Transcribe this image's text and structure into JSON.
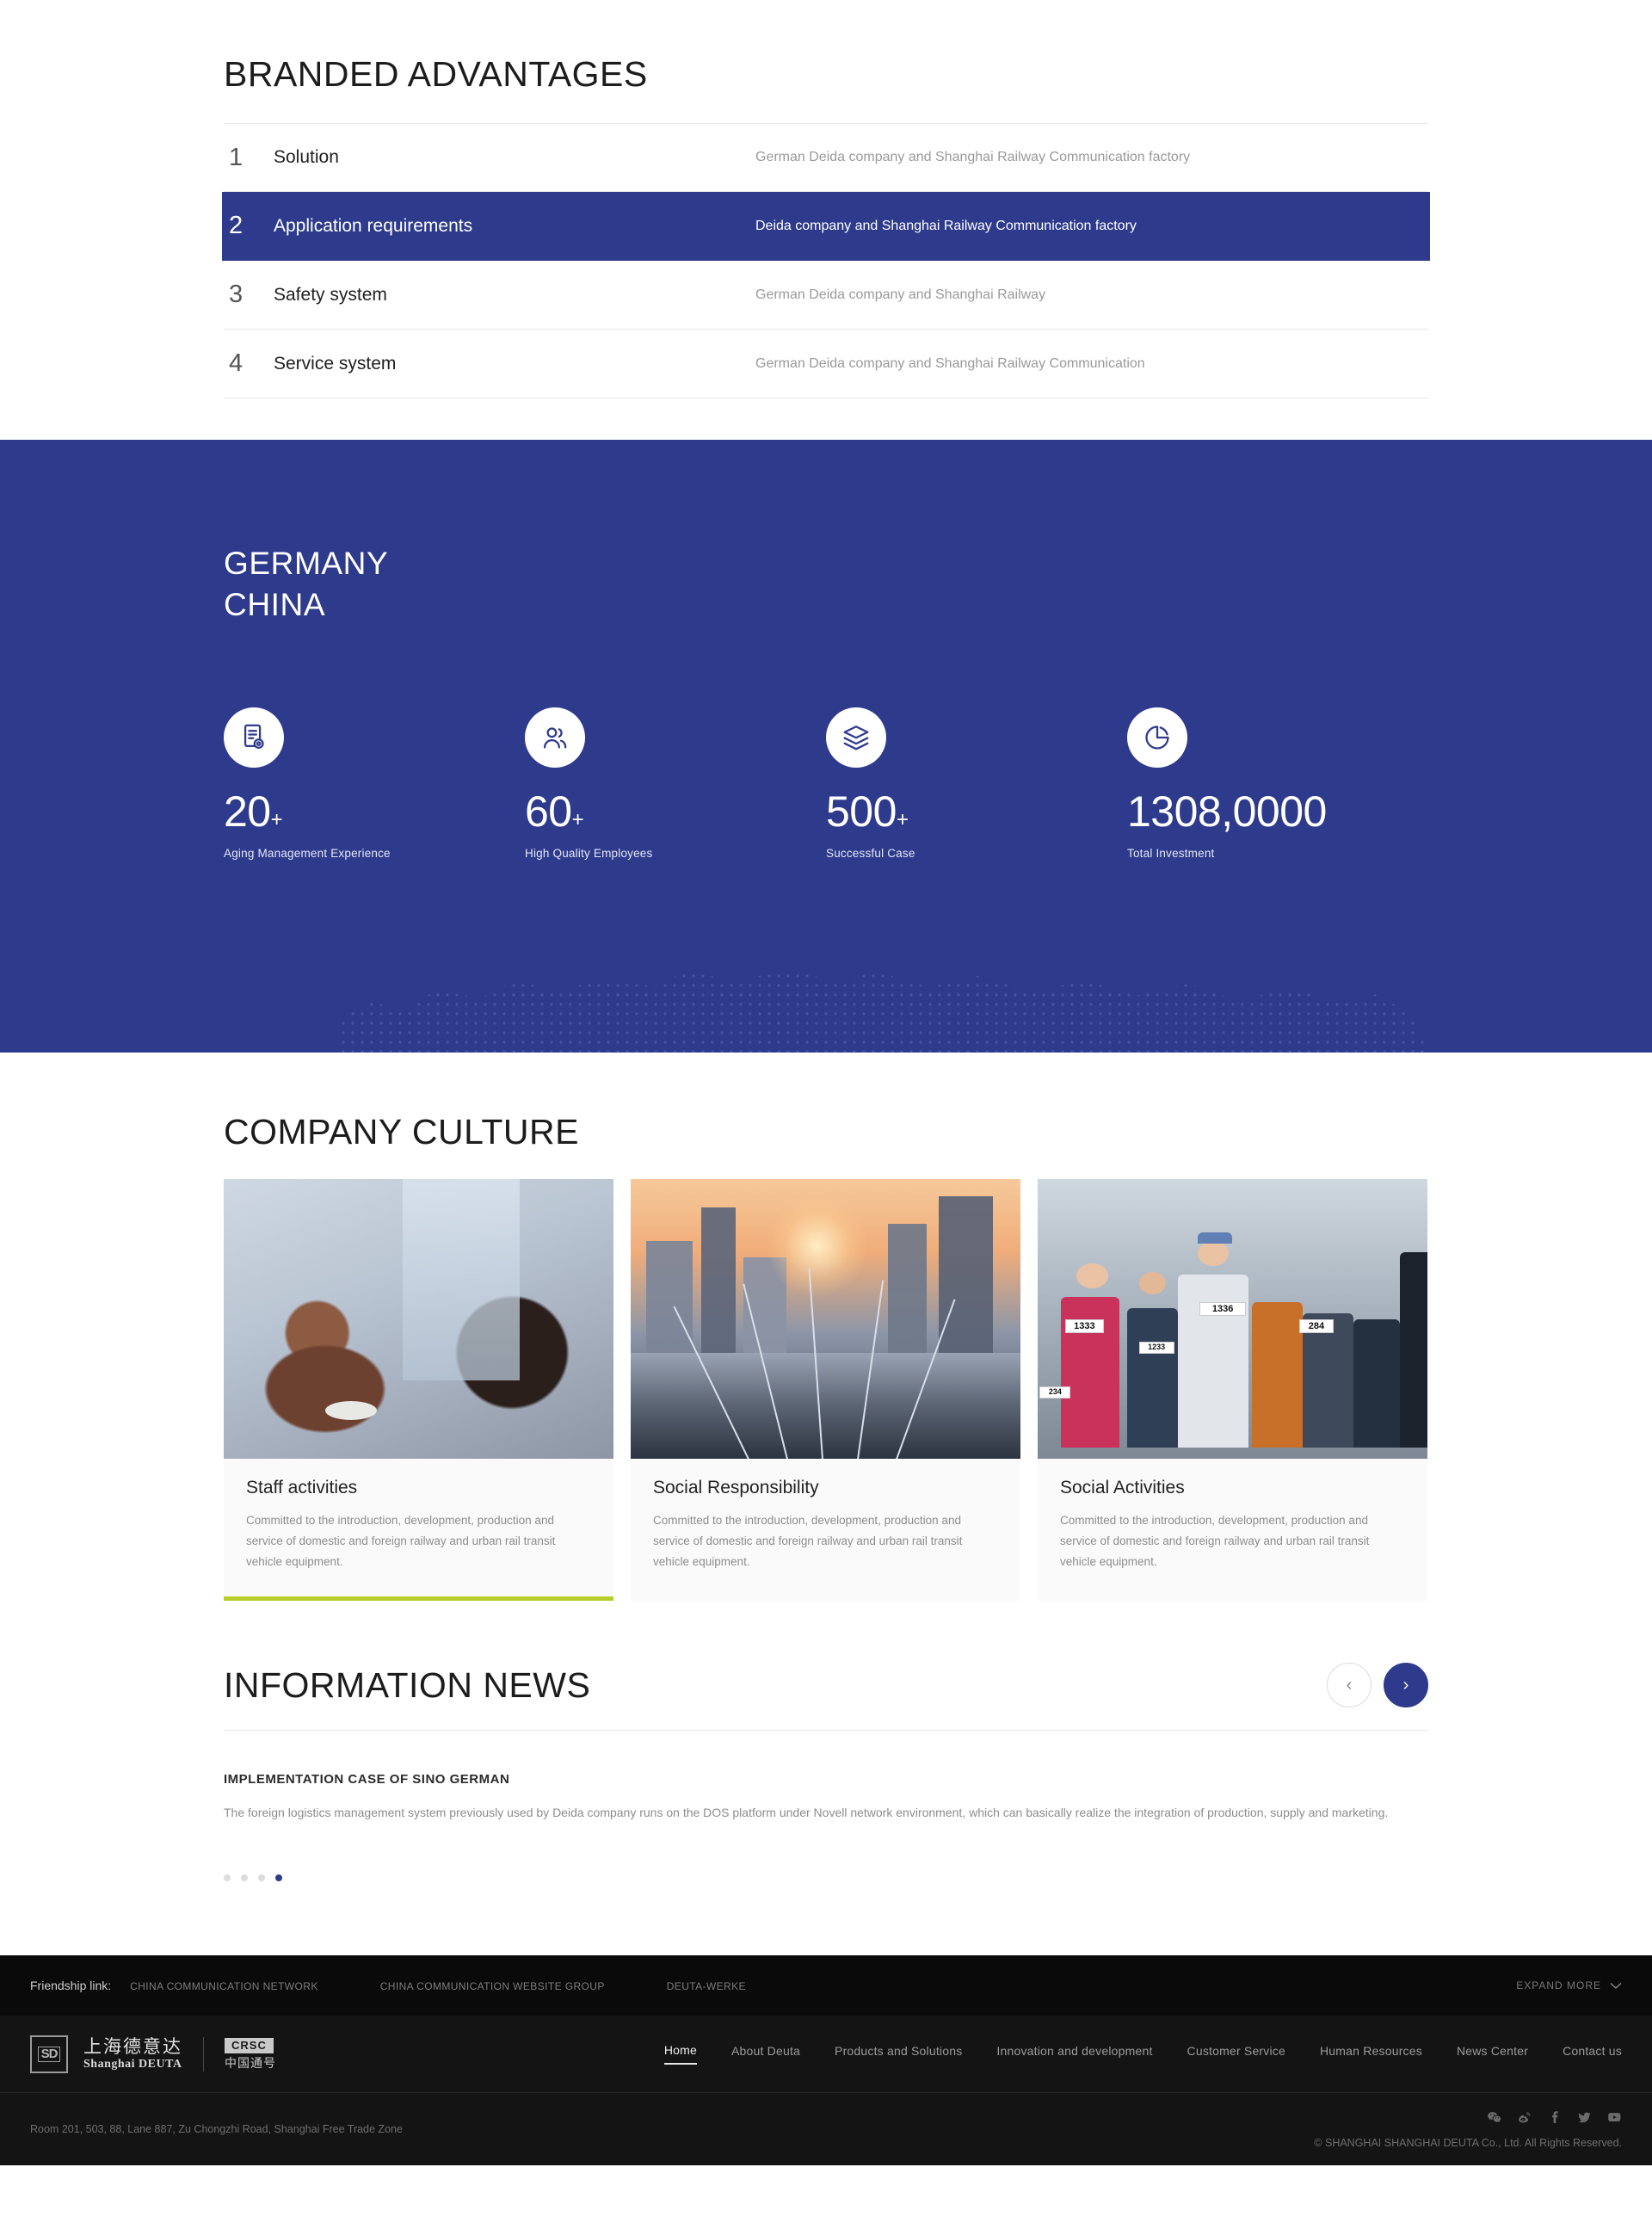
{
  "advantages": {
    "title": "BRANDED ADVANTAGES",
    "rows": [
      {
        "num": "1",
        "name": "Solution",
        "desc": "German Deida company and Shanghai Railway Communication factory"
      },
      {
        "num": "2",
        "name": "Application requirements",
        "desc": "Deida company and Shanghai Railway Communication factory"
      },
      {
        "num": "3",
        "name": "Safety system",
        "desc": "German Deida company and Shanghai Railway"
      },
      {
        "num": "4",
        "name": "Service system",
        "desc": "German Deida company and Shanghai Railway Communication"
      }
    ],
    "active_index": 1
  },
  "stats_band": {
    "line1": "GERMANY",
    "line2": "CHINA",
    "background_color": "#2e3b8c",
    "items": [
      {
        "icon": "certificate-icon",
        "value": "20",
        "suffix": "+",
        "label": "Aging Management Experience"
      },
      {
        "icon": "users-icon",
        "value": "60",
        "suffix": "+",
        "label": "High Quality Employees"
      },
      {
        "icon": "layers-icon",
        "value": "500",
        "suffix": "+",
        "label": "Successful Case"
      },
      {
        "icon": "pie-chart-icon",
        "value": "1308,0000",
        "suffix": "",
        "label": "Total Investment"
      }
    ]
  },
  "culture": {
    "title": "COMPANY CULTURE",
    "cards": [
      {
        "title": "Staff activities",
        "text": "Committed to the introduction, development, production and service of domestic and foreign railway and urban rail transit vehicle equipment.",
        "accent_color": "#b5ce2a",
        "image": "staff-activities-photo"
      },
      {
        "title": "Social Responsibility",
        "text": "Committed to the introduction, development, production and service of domestic and foreign railway and urban rail transit vehicle equipment.",
        "accent_color": "",
        "image": "city-railway-photo"
      },
      {
        "title": "Social Activities",
        "text": "Committed to the introduction, development, production and service of domestic and foreign railway and urban rail transit vehicle equipment.",
        "accent_color": "",
        "image": "marathon-runners-photo"
      }
    ],
    "race_bibs": [
      "1336",
      "1333",
      "1233",
      "284",
      "234"
    ]
  },
  "news": {
    "title": "INFORMATION NEWS",
    "prev_label": "‹",
    "next_label": "›",
    "item": {
      "title": "IMPLEMENTATION CASE OF SINO GERMAN",
      "text": "The foreign logistics management system previously used by Deida company runs on the DOS platform under Novell network environment, which can basically realize the integration of production, supply and marketing."
    },
    "dots": 4,
    "active_dot": 4
  },
  "footer": {
    "friendship_label": "Friendship link:",
    "friendship_links": [
      "CHINA COMMUNICATION NETWORK",
      "CHINA COMMUNICATION WEBSITE GROUP",
      "DEUTA-WERKE"
    ],
    "expand_more": "EXPAND MORE",
    "logo": {
      "mark": "SD",
      "cn_name": "上海德意达",
      "en_name": "Shanghai DEUTA",
      "partner_tag": "CRSC",
      "partner_cn": "中国通号"
    },
    "nav": [
      {
        "label": "Home",
        "active": true
      },
      {
        "label": "About  Deuta",
        "active": false
      },
      {
        "label": "Products and Solutions",
        "active": false
      },
      {
        "label": "Innovation and development",
        "active": false
      },
      {
        "label": "Customer Service",
        "active": false
      },
      {
        "label": "Human Resources",
        "active": false
      },
      {
        "label": "News Center",
        "active": false
      },
      {
        "label": "Contact us",
        "active": false
      }
    ],
    "address": "Room 201, 503, 88, Lane 887, Zu Chongzhi Road, Shanghai Free Trade Zone",
    "copyright": "© SHANGHAI SHANGHAI DEUTA Co., Ltd. All Rights Reserved.",
    "social": [
      "wechat-icon",
      "weibo-icon",
      "facebook-icon",
      "twitter-icon",
      "youtube-icon"
    ]
  }
}
